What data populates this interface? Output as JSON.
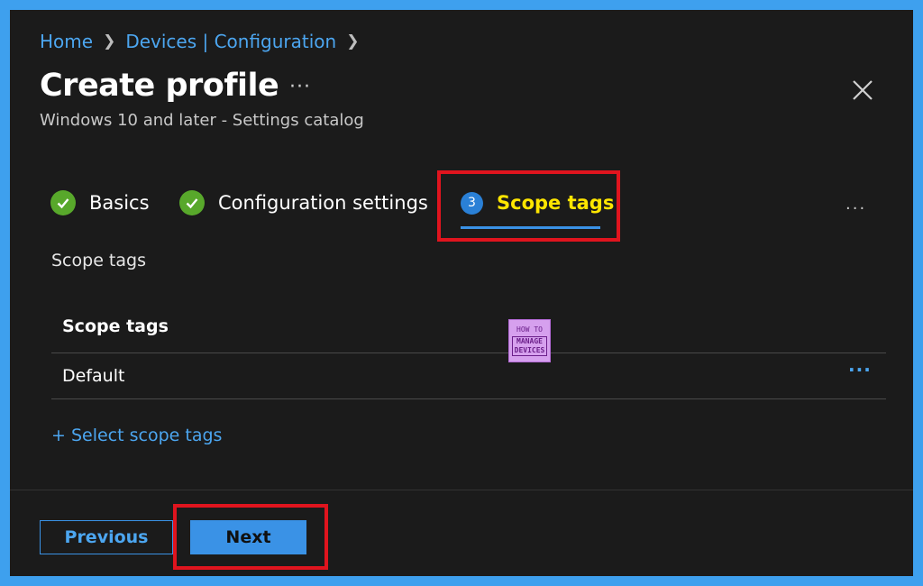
{
  "breadcrumb": [
    "Home",
    "Devices | Configuration"
  ],
  "header": {
    "title": "Create profile",
    "more_label": "···",
    "subtitle": "Windows 10 and later - Settings catalog"
  },
  "tabs": [
    {
      "label": "Basics",
      "state": "completed"
    },
    {
      "label": "Configuration settings",
      "state": "completed"
    },
    {
      "label": "Scope tags",
      "step": "3",
      "state": "active"
    }
  ],
  "tabs_more_label": "···",
  "section": {
    "title": "Scope tags",
    "table_header": "Scope tags",
    "rows": [
      {
        "value": "Default",
        "more_label": "···"
      }
    ],
    "select_link": "+ Select scope tags"
  },
  "watermark": {
    "line1": "HOW TO",
    "line2": "MANAGE",
    "line3": "DEVICES"
  },
  "footer": {
    "previous_label": "Previous",
    "next_label": "Next"
  },
  "colors": {
    "accent": "#3a92e6",
    "link": "#4ca6f0",
    "success": "#58a82b",
    "highlight": "#e0141e",
    "active_tab_text": "#ffe600",
    "background": "#1b1b1b",
    "outer_border": "#3ea0ee"
  },
  "icons": [
    "chevron-right-icon",
    "more-icon",
    "close-icon",
    "checkmark-icon"
  ]
}
